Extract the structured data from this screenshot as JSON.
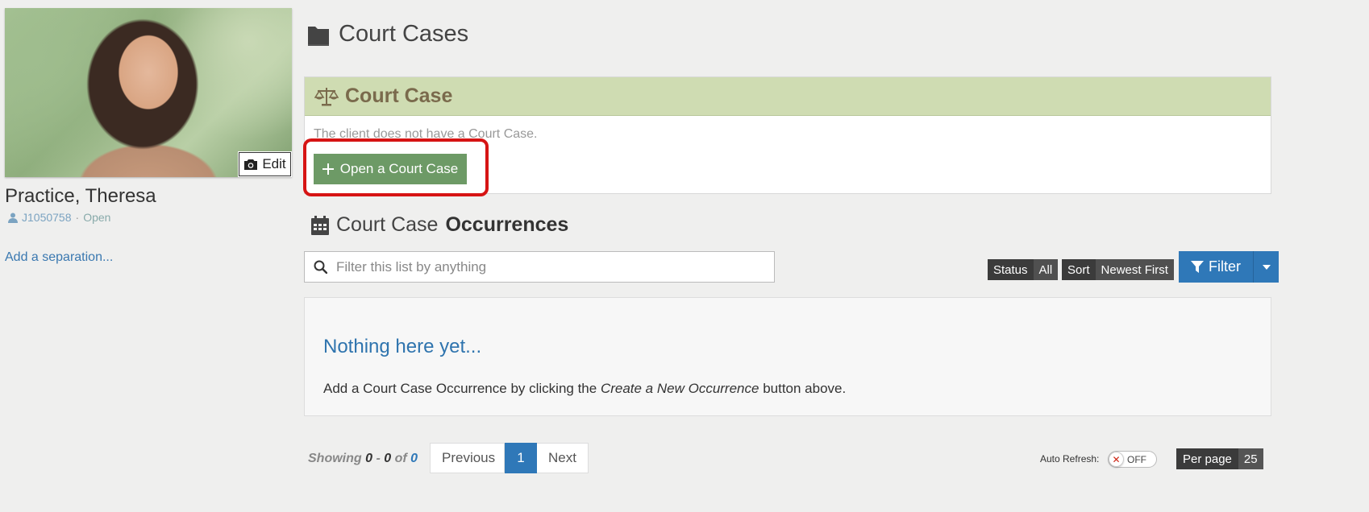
{
  "profile": {
    "edit_label": "Edit",
    "name": "Practice, Theresa",
    "client_id": "J1050758",
    "separator": "·",
    "status": "Open",
    "add_separation": "Add a separation..."
  },
  "page": {
    "title": "Court Cases"
  },
  "court_case_panel": {
    "title": "Court Case",
    "empty_text": "The client does not have a Court Case.",
    "open_button": "Open a Court Case"
  },
  "occurrences": {
    "title_prefix": "Court Case",
    "title_bold": "Occurrences",
    "search_placeholder": "Filter this list by anything",
    "status_key": "Status",
    "status_value": "All",
    "sort_key": "Sort",
    "sort_value": "Newest First",
    "filter_label": "Filter",
    "empty_title": "Nothing here yet...",
    "empty_desc_before": "Add a Court Case Occurrence by clicking the ",
    "empty_desc_em": "Create a New Occurrence",
    "empty_desc_after": " button above."
  },
  "footer": {
    "showing_label": "Showing",
    "range_start": "0",
    "range_sep": "-",
    "range_end": "0",
    "of_label": "of",
    "total": "0",
    "prev": "Previous",
    "current_page": "1",
    "next": "Next",
    "auto_refresh_label": "Auto Refresh:",
    "toggle_state": "OFF",
    "per_page_label": "Per page",
    "per_page_value": "25"
  },
  "colors": {
    "accent": "#2f78b8",
    "panel_header": "#cfdcb2",
    "open_button": "#6d9a66",
    "highlight": "#d61414"
  },
  "icons": [
    "camera-icon",
    "user-icon",
    "folder-icon",
    "balance-scale-icon",
    "plus-icon",
    "calendar-icon",
    "search-icon",
    "filter-icon",
    "caret-down-icon",
    "close-icon"
  ]
}
